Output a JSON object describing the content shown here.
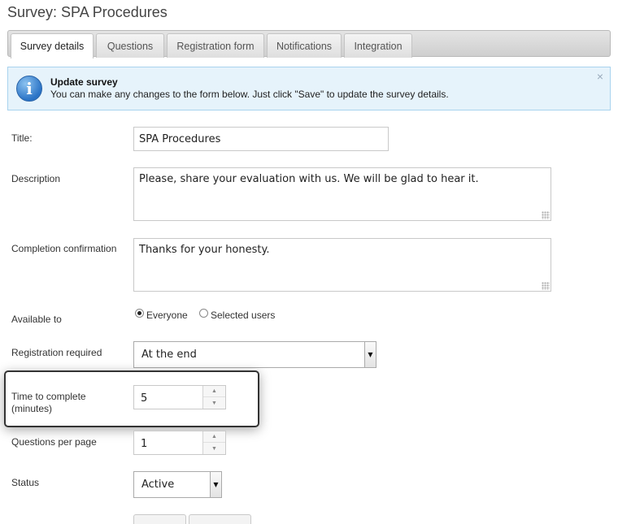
{
  "page": {
    "title": "Survey: SPA Procedures"
  },
  "tabs": [
    {
      "label": "Survey details",
      "active": true
    },
    {
      "label": "Questions",
      "active": false
    },
    {
      "label": "Registration form",
      "active": false
    },
    {
      "label": "Notifications",
      "active": false
    },
    {
      "label": "Integration",
      "active": false
    }
  ],
  "info": {
    "icon": "info-icon",
    "title": "Update survey",
    "text": "You can make any changes to the form below. Just click \"Save\" to update the survey details.",
    "close": "×"
  },
  "form": {
    "title_label": "Title:",
    "title_value": "SPA Procedures",
    "description_label": "Description",
    "description_value": "Please, share your evaluation with us. We will be glad to hear it.",
    "completion_label": "Completion confirmation",
    "completion_value": "Thanks for your honesty.",
    "available_label": "Available to",
    "available_options": [
      "Everyone",
      "Selected users"
    ],
    "available_selected": "Everyone",
    "registration_label": "Registration required",
    "registration_value": "At the end",
    "time_label_line1": "Time to complete",
    "time_label_line2": "(minutes)",
    "time_value": "5",
    "questions_label": "Questions per page",
    "questions_value": "1",
    "status_label": "Status",
    "status_value": "Active"
  },
  "glyphs": {
    "dropdown": "▼",
    "spin_up": "▲",
    "spin_down": "▼"
  },
  "colors": {
    "info_bg": "#e6f3fb",
    "info_border": "#a9d3ee",
    "info_icon": "#2a73c6"
  }
}
